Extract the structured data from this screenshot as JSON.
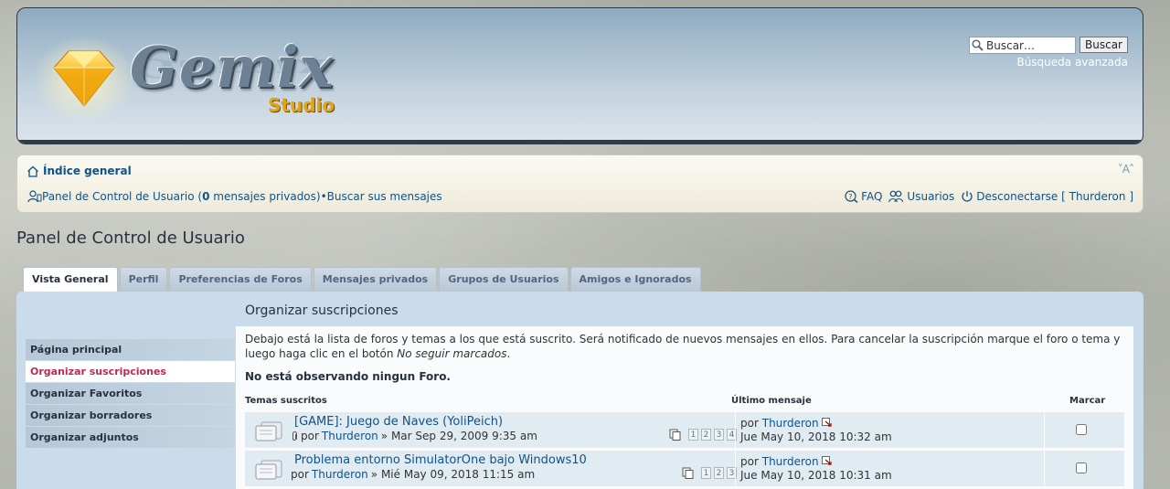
{
  "header": {
    "logo_text": "Gemix",
    "logo_subtext": "Studio",
    "search": {
      "placeholder": "Buscar…",
      "value": "Buscar…",
      "button_label": "Buscar",
      "advanced_label": "Búsqueda avanzada"
    }
  },
  "navbar": {
    "home_label": "Índice general",
    "font_control": "˅A˄",
    "ucp_label": "Panel de Control de Usuario (",
    "pm_count": "0",
    "pm_label": " mensajes privados)",
    "bullet": " • ",
    "search_own": "Buscar sus mensajes",
    "faq": "FAQ",
    "users": "Usuarios",
    "logout": "Desconectarse [ Thurderon ]"
  },
  "page_title": "Panel de Control de Usuario",
  "tabs": [
    {
      "label": "Vista General",
      "active": true
    },
    {
      "label": "Perfil"
    },
    {
      "label": "Preferencias de Foros"
    },
    {
      "label": "Mensajes privados"
    },
    {
      "label": "Grupos de Usuarios"
    },
    {
      "label": "Amigos e Ignorados"
    }
  ],
  "sidebar": {
    "items": [
      {
        "label": "Página principal"
      },
      {
        "label": "Organizar suscripciones",
        "active": true
      },
      {
        "label": "Organizar Favoritos"
      },
      {
        "label": "Organizar borradores"
      },
      {
        "label": "Organizar adjuntos"
      }
    ]
  },
  "main": {
    "title": "Organizar suscripciones",
    "description_1": "Debajo está la lista de foros y temas a los que está suscrito. Será notificado de nuevos mensajes en ellos. Para cancelar la suscripción marque el foro o tema y luego haga clic en el botón ",
    "description_em": "No seguir marcados",
    "description_2": ".",
    "no_forum": "No está observando ningun Foro.",
    "columns": {
      "topics": "Temas suscritos",
      "last_post": "Último mensaje",
      "mark": "Marcar"
    },
    "topics": [
      {
        "title": "[GAME]: Juego de Naves (YoliPeich)",
        "by_label": "por",
        "author": "Thurderon",
        "date": "» Mar Sep 29, 2009 9:35 am",
        "pages": [
          "1",
          "2",
          "3",
          "4"
        ],
        "last_by_label": "por",
        "last_author": "Thurderon",
        "last_date": "Jue May 10, 2018 10:32 am"
      },
      {
        "title": "Problema entorno SimulatorOne bajo Windows10",
        "by_label": "por",
        "author": "Thurderon",
        "date": "» Mié May 09, 2018 11:15 am",
        "pages": [
          "1",
          "2",
          "3"
        ],
        "last_by_label": "por",
        "last_author": "Thurderon",
        "last_date": "Jue May 10, 2018 10:31 am"
      }
    ]
  },
  "colors": {
    "link": "#105289",
    "active_side": "#bc2a4d",
    "panel_bg": "#cadceb",
    "row_bg": "#e1ebf2"
  }
}
